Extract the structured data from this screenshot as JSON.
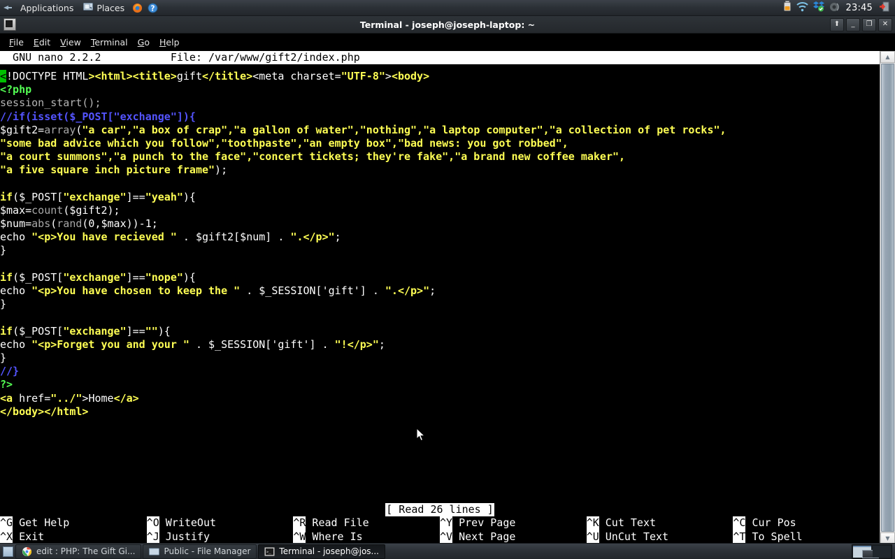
{
  "panel": {
    "launcher_icon": "mouse-pointer-launcher-icon",
    "applications_label": "Applications",
    "places_label": "Places",
    "firefox_icon": "firefox-icon",
    "help_icon": "help-icon",
    "tray": {
      "battery_icon": "battery-icon",
      "network_icon": "wifi-icon",
      "dropbox_icon": "dropbox-icon",
      "volume_icon": "speaker-icon",
      "clock": "23:45",
      "logout_icon": "logout-icon"
    }
  },
  "window": {
    "icon": "terminal-icon",
    "title": "Terminal - joseph@joseph-laptop: ~",
    "buttons": {
      "shade": "⬆",
      "minimize": "_",
      "maximize": "❐",
      "close": "✕"
    },
    "menubar": [
      {
        "label": "File",
        "accel": "F"
      },
      {
        "label": "Edit",
        "accel": "E"
      },
      {
        "label": "View",
        "accel": "V"
      },
      {
        "label": "Terminal",
        "accel": "T"
      },
      {
        "label": "Go",
        "accel": "G"
      },
      {
        "label": "Help",
        "accel": "H"
      }
    ]
  },
  "nano": {
    "version_label": "GNU nano 2.2.2",
    "file_label": "File: /var/www/gift2/index.php",
    "status_message": "[ Read 26 lines ]",
    "cursor_char": "<",
    "lines": [
      [
        {
          "t": "<",
          "c": "cursor-cell"
        },
        {
          "t": "!DOCTYPE HTML",
          "c": "c-plain"
        },
        {
          "t": "><html><title>",
          "c": "c-tag"
        },
        {
          "t": "gift",
          "c": "c-plain"
        },
        {
          "t": "</title>",
          "c": "c-tag"
        },
        {
          "t": "<meta charset=",
          "c": "c-plain"
        },
        {
          "t": "\"UTF-8\"",
          "c": "c-str"
        },
        {
          "t": ">",
          "c": "c-plain"
        },
        {
          "t": "<body>",
          "c": "c-tag"
        }
      ],
      [
        {
          "t": "<?php",
          "c": "c-php"
        }
      ],
      [
        {
          "t": "session_start();",
          "c": "c-dim"
        }
      ],
      [
        {
          "t": "//if(isset($_POST[\"exchange\"]){",
          "c": "c-comment"
        }
      ],
      [
        {
          "t": "$gift2=",
          "c": "c-var"
        },
        {
          "t": "array",
          "c": "c-func"
        },
        {
          "t": "(",
          "c": "c-var"
        },
        {
          "t": "\"a car\",\"a box of crap\",\"a gallon of water\",\"nothing\",\"a laptop computer\",\"a collection of pet rocks\",",
          "c": "c-str"
        }
      ],
      [
        {
          "t": "\"some bad advice which you follow\",\"toothpaste\",\"an empty box\",\"bad news: you got robbed\",",
          "c": "c-str"
        }
      ],
      [
        {
          "t": "\"a court summons\",\"a punch to the face\",\"concert tickets; they're fake\",\"a brand new coffee maker\",",
          "c": "c-str"
        }
      ],
      [
        {
          "t": "\"a five square inch picture frame\"",
          "c": "c-str"
        },
        {
          "t": ");",
          "c": "c-var"
        }
      ],
      [
        {
          "t": "",
          "c": "c-plain"
        }
      ],
      [
        {
          "t": "if",
          "c": "c-kw"
        },
        {
          "t": "($_POST[",
          "c": "c-var"
        },
        {
          "t": "\"exchange\"",
          "c": "c-str"
        },
        {
          "t": "]==",
          "c": "c-var"
        },
        {
          "t": "\"yeah\"",
          "c": "c-str"
        },
        {
          "t": "){",
          "c": "c-var"
        }
      ],
      [
        {
          "t": "$max=",
          "c": "c-var"
        },
        {
          "t": "count",
          "c": "c-func"
        },
        {
          "t": "($gift2);",
          "c": "c-var"
        }
      ],
      [
        {
          "t": "$num=",
          "c": "c-var"
        },
        {
          "t": "abs",
          "c": "c-func"
        },
        {
          "t": "(",
          "c": "c-var"
        },
        {
          "t": "rand",
          "c": "c-func"
        },
        {
          "t": "(0,$max))-1;",
          "c": "c-var"
        }
      ],
      [
        {
          "t": "echo ",
          "c": "c-var"
        },
        {
          "t": "\"<p>You have recieved \"",
          "c": "c-str"
        },
        {
          "t": " . $gift2[$num] . ",
          "c": "c-var"
        },
        {
          "t": "\".</p>\"",
          "c": "c-str"
        },
        {
          "t": ";",
          "c": "c-var"
        }
      ],
      [
        {
          "t": "}",
          "c": "c-var"
        }
      ],
      [
        {
          "t": "",
          "c": "c-plain"
        }
      ],
      [
        {
          "t": "if",
          "c": "c-kw"
        },
        {
          "t": "($_POST[",
          "c": "c-var"
        },
        {
          "t": "\"exchange\"",
          "c": "c-str"
        },
        {
          "t": "]==",
          "c": "c-var"
        },
        {
          "t": "\"nope\"",
          "c": "c-str"
        },
        {
          "t": "){",
          "c": "c-var"
        }
      ],
      [
        {
          "t": "echo ",
          "c": "c-var"
        },
        {
          "t": "\"<p>You have chosen to keep the \"",
          "c": "c-str"
        },
        {
          "t": " . $_SESSION['gift'] . ",
          "c": "c-var"
        },
        {
          "t": "\".</p>\"",
          "c": "c-str"
        },
        {
          "t": ";",
          "c": "c-var"
        }
      ],
      [
        {
          "t": "}",
          "c": "c-var"
        }
      ],
      [
        {
          "t": "",
          "c": "c-plain"
        }
      ],
      [
        {
          "t": "if",
          "c": "c-kw"
        },
        {
          "t": "($_POST[",
          "c": "c-var"
        },
        {
          "t": "\"exchange\"",
          "c": "c-str"
        },
        {
          "t": "]==",
          "c": "c-var"
        },
        {
          "t": "\"\"",
          "c": "c-str"
        },
        {
          "t": "){",
          "c": "c-var"
        }
      ],
      [
        {
          "t": "echo ",
          "c": "c-var"
        },
        {
          "t": "\"<p>Forget you and your \"",
          "c": "c-str"
        },
        {
          "t": " . $_SESSION['gift'] . ",
          "c": "c-var"
        },
        {
          "t": "\"!</p>\"",
          "c": "c-str"
        },
        {
          "t": ";",
          "c": "c-var"
        }
      ],
      [
        {
          "t": "}",
          "c": "c-var"
        }
      ],
      [
        {
          "t": "//}",
          "c": "c-comment"
        }
      ],
      [
        {
          "t": "?>",
          "c": "c-php"
        }
      ],
      [
        {
          "t": "<a",
          "c": "c-tag"
        },
        {
          "t": " href=",
          "c": "c-plain"
        },
        {
          "t": "\"../\"",
          "c": "c-str"
        },
        {
          "t": ">",
          "c": "c-plain"
        },
        {
          "t": "Home",
          "c": "c-plain"
        },
        {
          "t": "</a>",
          "c": "c-tag"
        }
      ],
      [
        {
          "t": "</body></html>",
          "c": "c-tag"
        }
      ]
    ],
    "shortcuts": [
      [
        {
          "key": "^G",
          "label": "Get Help"
        },
        {
          "key": "^O",
          "label": "WriteOut"
        },
        {
          "key": "^R",
          "label": "Read File"
        },
        {
          "key": "^Y",
          "label": "Prev Page"
        },
        {
          "key": "^K",
          "label": "Cut Text"
        },
        {
          "key": "^C",
          "label": "Cur Pos"
        }
      ],
      [
        {
          "key": "^X",
          "label": "Exit"
        },
        {
          "key": "^J",
          "label": "Justify"
        },
        {
          "key": "^W",
          "label": "Where Is"
        },
        {
          "key": "^V",
          "label": "Next Page"
        },
        {
          "key": "^U",
          "label": "UnCut Text"
        },
        {
          "key": "^T",
          "label": "To Spell"
        }
      ]
    ]
  },
  "scrollbar": {
    "up_arrow_icon": "chevron-up-icon",
    "down_arrow_icon": "chevron-down-icon"
  },
  "taskbar": {
    "show_desktop_icon": "show-desktop-icon",
    "items": [
      {
        "icon": "chrome-icon",
        "label": "edit : PHP: The Gift Gi...",
        "active": false
      },
      {
        "icon": "folder-icon",
        "label": "Public - File Manager",
        "active": false
      },
      {
        "icon": "terminal-icon",
        "label": "Terminal - joseph@jos...",
        "active": true
      }
    ],
    "pager_icon": "workspace-switcher"
  },
  "colors": {
    "panel_bg": "#2b3036",
    "terminal_bg": "#000000",
    "nano_bar_bg": "#ffffff",
    "cursor_green": "#00c000",
    "string_yellow": "#ffff54",
    "comment_blue": "#5454ff",
    "php_green": "#54ff54"
  }
}
